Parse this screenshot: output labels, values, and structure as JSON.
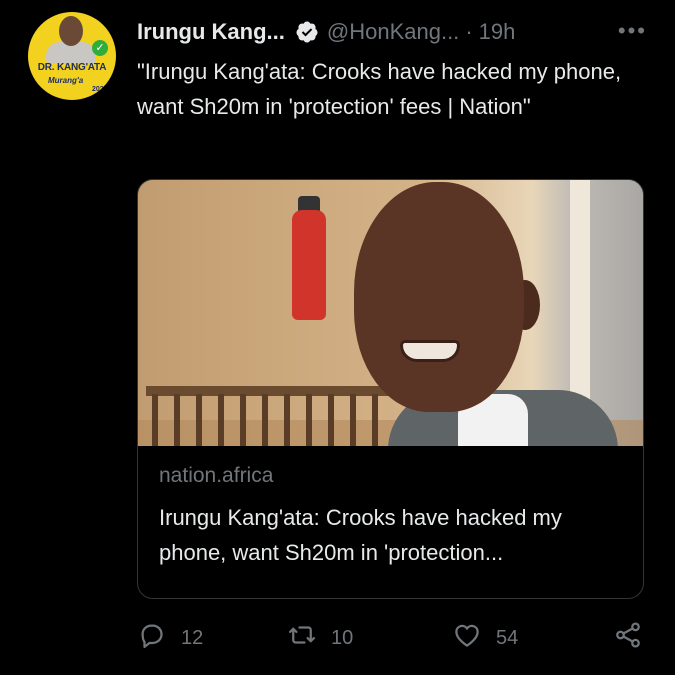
{
  "author": {
    "name": "Irungu Kang...",
    "handle": "@HonKang...",
    "separator": "·",
    "time": "19h",
    "avatar_text": {
      "brand": "DR. KANG'ATA",
      "script": "Murang'a",
      "year": "2022"
    }
  },
  "tweet": {
    "text": "\"Irungu Kang'ata: Crooks have hacked my phone, want Sh20m in 'protection' fees | Nation\""
  },
  "card": {
    "domain": "nation.africa",
    "title": "Irungu Kang'ata: Crooks have hacked my phone, want Sh20m in 'protection..."
  },
  "actions": {
    "replies": "12",
    "retweets": "10",
    "likes": "54"
  },
  "icons": {
    "verified": "verified-badge-icon",
    "more": "more-icon",
    "reply": "reply-icon",
    "retweet": "retweet-icon",
    "like": "heart-icon",
    "share": "share-icon"
  },
  "colors": {
    "background": "#000000",
    "text": "#e7e9ea",
    "secondary": "#71767b",
    "border": "#333639"
  }
}
